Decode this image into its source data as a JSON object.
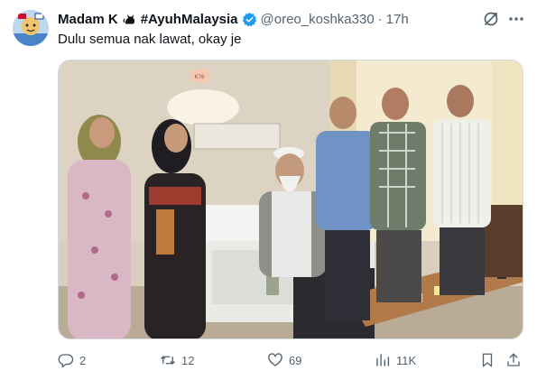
{
  "tweet": {
    "display_name": "Madam K",
    "name_tag": "#AyuhMalaysia",
    "handle": "@oreo_koshka330",
    "separator": "·",
    "time": "17h",
    "text": "Dulu semua nak lawat, okay je"
  },
  "media": {
    "room_sign": "K76"
  },
  "actions": {
    "replies": "2",
    "reposts": "12",
    "likes": "69",
    "views": "11K"
  },
  "colors": {
    "verified": "#1d9bf0",
    "secondary_text": "#536471",
    "primary_text": "#0f1419",
    "border": "#cfd9de"
  },
  "icons": {
    "cat": "cat-icon",
    "verified": "verified-badge-icon",
    "grok": "grok-icon",
    "more": "more-icon",
    "reply": "reply-icon",
    "repost": "repost-icon",
    "like": "heart-icon",
    "views": "views-icon",
    "bookmark": "bookmark-icon",
    "share": "share-icon"
  }
}
